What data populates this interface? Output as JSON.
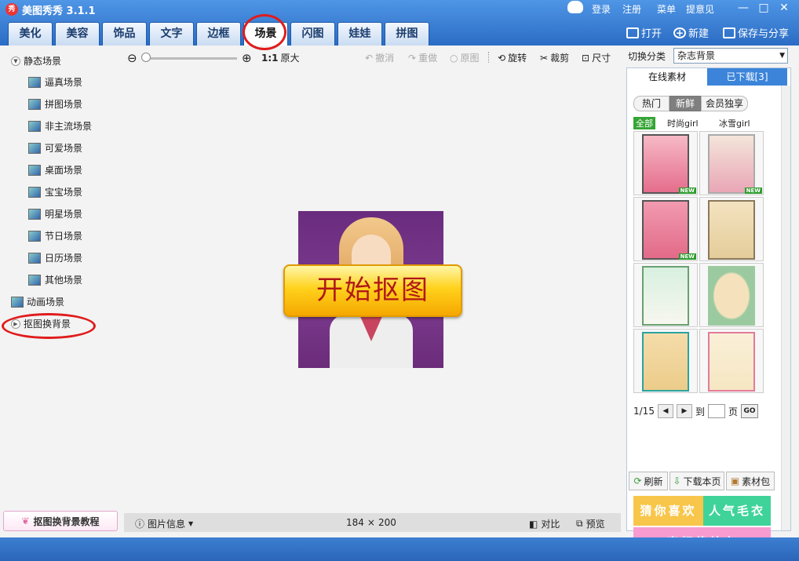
{
  "app": {
    "logo_text": "秀",
    "title": "美图秀秀 3.1.1"
  },
  "top_links": [
    "登录",
    "注册",
    "菜单",
    "提意见"
  ],
  "window_controls": {
    "minimize": "—",
    "maximize": "□",
    "close": "✕"
  },
  "tabs": [
    {
      "label": "美化"
    },
    {
      "label": "美容"
    },
    {
      "label": "饰品"
    },
    {
      "label": "文字"
    },
    {
      "label": "边框"
    },
    {
      "label": "场景",
      "active": true
    },
    {
      "label": "闪图"
    },
    {
      "label": "娃娃"
    },
    {
      "label": "拼图"
    }
  ],
  "toolbar_actions": {
    "open": "打开",
    "new": "新建",
    "save_share": "保存与分享"
  },
  "left_tree": {
    "static_group": "静态场景",
    "static_items": [
      "逼真场景",
      "拼图场景",
      "非主流场景",
      "可爱场景",
      "桌面场景",
      "宝宝场景",
      "明星场景",
      "节日场景",
      "日历场景",
      "其他场景"
    ],
    "animated_group": "动画场景",
    "cutout_group": "抠图换背景"
  },
  "canvas_toolbar": {
    "zoom_ratio": "1:1",
    "original_size": "原大",
    "undo": "撤消",
    "redo": "重做",
    "original": "原图",
    "rotate": "旋转",
    "crop": "裁剪",
    "size": "尺寸"
  },
  "canvas": {
    "start_button": "开始抠图"
  },
  "bottom": {
    "tutorial": "抠图换背景教程",
    "image_info": "图片信息",
    "width": "184",
    "times": "×",
    "height": "200",
    "compare": "对比",
    "preview": "预览"
  },
  "right_panel": {
    "switch_label": "切换分类",
    "category_value": "杂志背景",
    "tab_online": "在线素材",
    "tab_downloaded": "已下载[3]",
    "filter_pills": [
      "热门",
      "新鲜",
      "会员独享"
    ],
    "sub_filters": [
      "全部",
      "时尚girl",
      "冰雪girl"
    ],
    "new_badge": "NEW",
    "page_indicator": "1/15",
    "goto_label": "到",
    "page_label": "页",
    "go_label": "GO",
    "refresh": "刷新",
    "download_page": "下载本页",
    "material_pack": "素材包",
    "promos": [
      "猜你喜欢",
      "人气毛衣",
      "高颜值美衣"
    ]
  },
  "colors": {
    "title_bar": "#2b6cc4",
    "annotation_red": "#e01c1c",
    "promo_yellow": "#f8c64a",
    "promo_green": "#3fd39a",
    "promo_pink": "#f79bd0",
    "start_button_text": "#b01818"
  },
  "icons": {
    "logo": "xiu-logo-icon",
    "mascot": "mascot-icon",
    "open": "folder-icon",
    "new": "plus-circle-icon",
    "save": "disk-icon",
    "zoom_out": "zoom-out-icon",
    "zoom_in": "zoom-in-icon"
  }
}
